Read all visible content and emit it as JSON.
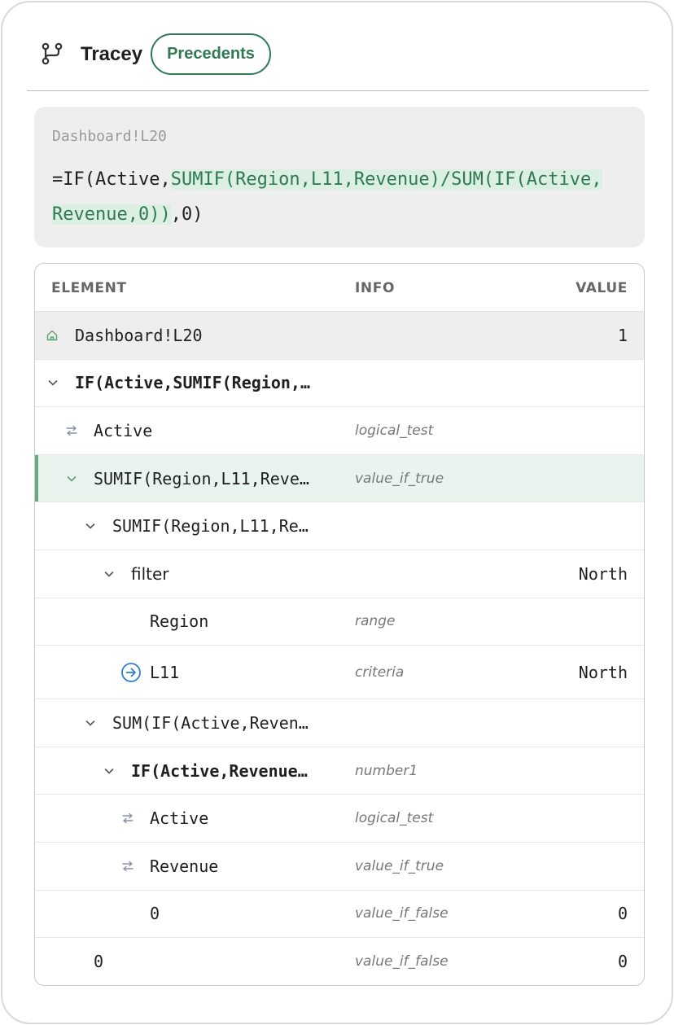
{
  "header": {
    "app_name": "Tracey",
    "mode_label": "Precedents",
    "app_icon": "git-branch-icon"
  },
  "formula_card": {
    "cell_ref": "Dashboard!L20",
    "formula_prefix": "=IF(Active,",
    "formula_highlight_1": "SUMIF(Region,L11,Revenue)/SUM(IF(Active,",
    "formula_highlight_2": "Revenue,0))",
    "formula_suffix": ",0)",
    "highlight_color": "#dcefe3",
    "highlight_text_color": "#2f7a52"
  },
  "table": {
    "headers": {
      "element": "ELEMENT",
      "info": "INFO",
      "value": "VALUE"
    },
    "rows": [
      {
        "element": "Dashboard!L20",
        "info": "",
        "value": "1",
        "icon": "home-icon"
      },
      {
        "element": "IF(Active,SUMIF(Region,…",
        "info": "",
        "value": "",
        "icon": "chevron-down-icon"
      },
      {
        "element": "Active",
        "info": "logical_test",
        "value": "",
        "icon": "swap-arrows-icon"
      },
      {
        "element": "SUMIF(Region,L11,Reve…",
        "info": "value_if_true",
        "value": "",
        "icon": "chevron-down-icon",
        "selected": true
      },
      {
        "element": "SUMIF(Region,L11,Re…",
        "info": "",
        "value": "",
        "icon": "chevron-down-icon"
      },
      {
        "element": "filter",
        "info": "",
        "value": "North",
        "icon": "chevron-down-icon"
      },
      {
        "element": "Region",
        "info": "range",
        "value": "",
        "icon": ""
      },
      {
        "element": "L11",
        "info": "criteria",
        "value": "North",
        "icon": "arrow-right-circle-icon"
      },
      {
        "element": "SUM(IF(Active,Reven…",
        "info": "",
        "value": "",
        "icon": "chevron-down-icon"
      },
      {
        "element": "IF(Active,Revenue…",
        "info": "number1",
        "value": "",
        "icon": "chevron-down-icon"
      },
      {
        "element": "Active",
        "info": "logical_test",
        "value": "",
        "icon": "swap-arrows-icon"
      },
      {
        "element": "Revenue",
        "info": "value_if_true",
        "value": "",
        "icon": "swap-arrows-icon"
      },
      {
        "element": "0",
        "info": "value_if_false",
        "value": "0",
        "icon": ""
      },
      {
        "element": "0",
        "info": "value_if_false",
        "value": "0",
        "icon": ""
      }
    ]
  },
  "colors": {
    "accent": "#2f7a52",
    "selected_row_bg": "#eaf4ee",
    "selected_row_bar": "#6aa985",
    "link_icon": "#2b7fd6"
  }
}
